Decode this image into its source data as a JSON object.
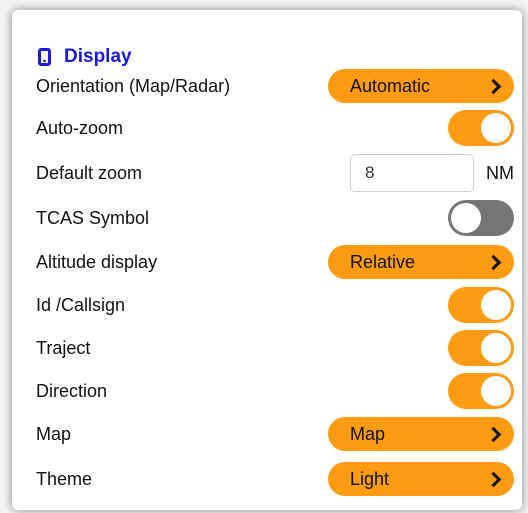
{
  "section": {
    "title": "Display",
    "icon": "phone-icon",
    "accent": "#1a1adf"
  },
  "colors": {
    "accent": "#fd9c12",
    "toggle_off": "#767676"
  },
  "rows": {
    "orientation": {
      "label": "Orientation (Map/Radar)",
      "value": "Automatic"
    },
    "auto_zoom": {
      "label": "Auto-zoom",
      "on": true
    },
    "default_zoom": {
      "label": "Default zoom",
      "value": "8",
      "unit": "NM"
    },
    "tcas_symbol": {
      "label": "TCAS Symbol",
      "on": false
    },
    "altitude_display": {
      "label": "Altitude display",
      "value": "Relative"
    },
    "id_callsign": {
      "label": "Id /Callsign",
      "on": true
    },
    "traject": {
      "label": "Traject",
      "on": true
    },
    "direction": {
      "label": "Direction",
      "on": true
    },
    "map": {
      "label": "Map",
      "value": "Map"
    },
    "theme": {
      "label": "Theme",
      "value": "Light"
    }
  }
}
